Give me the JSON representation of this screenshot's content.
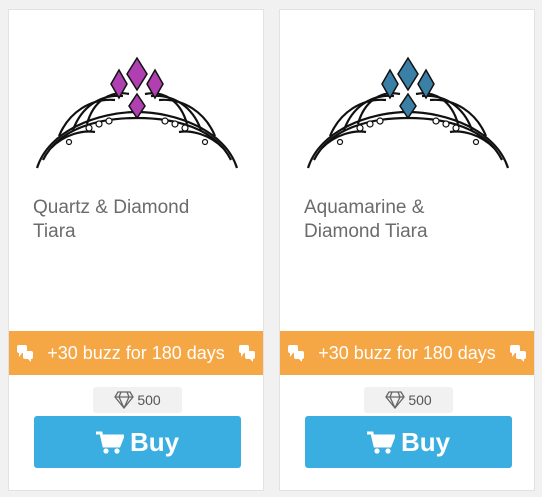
{
  "products": [
    {
      "name": "Quartz & Diamond Tiara",
      "gem_color": "#b03fb2",
      "buzz": "+30 buzz for 180 days",
      "price": "500",
      "buy_label": "Buy"
    },
    {
      "name": "Aquamarine & Diamond Tiara",
      "gem_color": "#3a7fa6",
      "buzz": "+30 buzz for 180 days",
      "price": "500",
      "buy_label": "Buy"
    }
  ],
  "colors": {
    "buzz_banner": "#f6a745",
    "buy_button": "#3aaee0"
  },
  "icons": [
    "tiara-image",
    "chat-bubbles-icon",
    "diamond-icon",
    "cart-icon"
  ]
}
